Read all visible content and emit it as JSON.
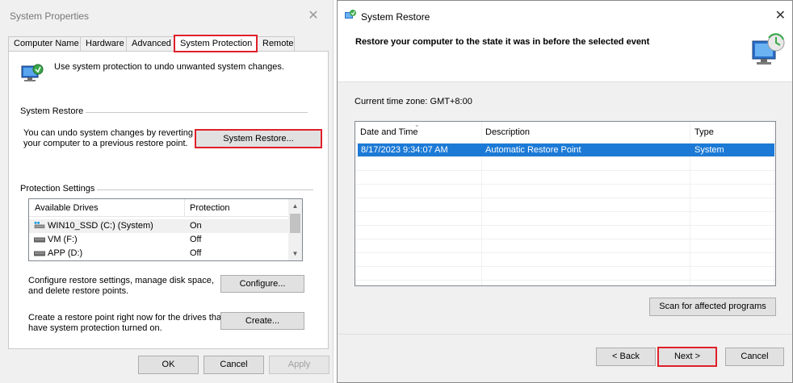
{
  "system_properties": {
    "title": "System Properties",
    "tabs": [
      {
        "label": "Computer Name"
      },
      {
        "label": "Hardware"
      },
      {
        "label": "Advanced"
      },
      {
        "label": "System Protection"
      },
      {
        "label": "Remote"
      }
    ],
    "intro": "Use system protection to undo unwanted system changes.",
    "restore_group": "System Restore",
    "restore_desc_1": "You can undo system changes by reverting",
    "restore_desc_2": "your computer to a previous restore point.",
    "restore_button": "System Restore...",
    "protection_group": "Protection Settings",
    "drives_header": {
      "drives": "Available Drives",
      "protection": "Protection"
    },
    "drives": [
      {
        "name": "WIN10_SSD (C:) (System)",
        "protection": "On"
      },
      {
        "name": "VM (F:)",
        "protection": "Off"
      },
      {
        "name": "APP (D:)",
        "protection": "Off"
      }
    ],
    "configure_desc_1": "Configure restore settings, manage disk space,",
    "configure_desc_2": "and delete restore points.",
    "configure_button": "Configure...",
    "create_desc_1": "Create a restore point right now for the drives that",
    "create_desc_2": "have system protection turned on.",
    "create_button": "Create...",
    "ok_button": "OK",
    "cancel_button": "Cancel",
    "apply_button": "Apply"
  },
  "system_restore": {
    "title": "System Restore",
    "heading": "Restore your computer to the state it was in before the selected event",
    "timezone": "Current time zone: GMT+8:00",
    "columns": {
      "date": "Date and Time",
      "description": "Description",
      "type": "Type"
    },
    "rows": [
      {
        "date": "8/17/2023 9:34:07 AM",
        "description": "Automatic Restore Point",
        "type": "System"
      }
    ],
    "scan_button": "Scan for affected programs",
    "back_button": "< Back",
    "next_button": "Next >",
    "cancel_button": "Cancel"
  },
  "colors": {
    "highlight_border": "#e0202a",
    "selection": "#1c7ad6"
  }
}
